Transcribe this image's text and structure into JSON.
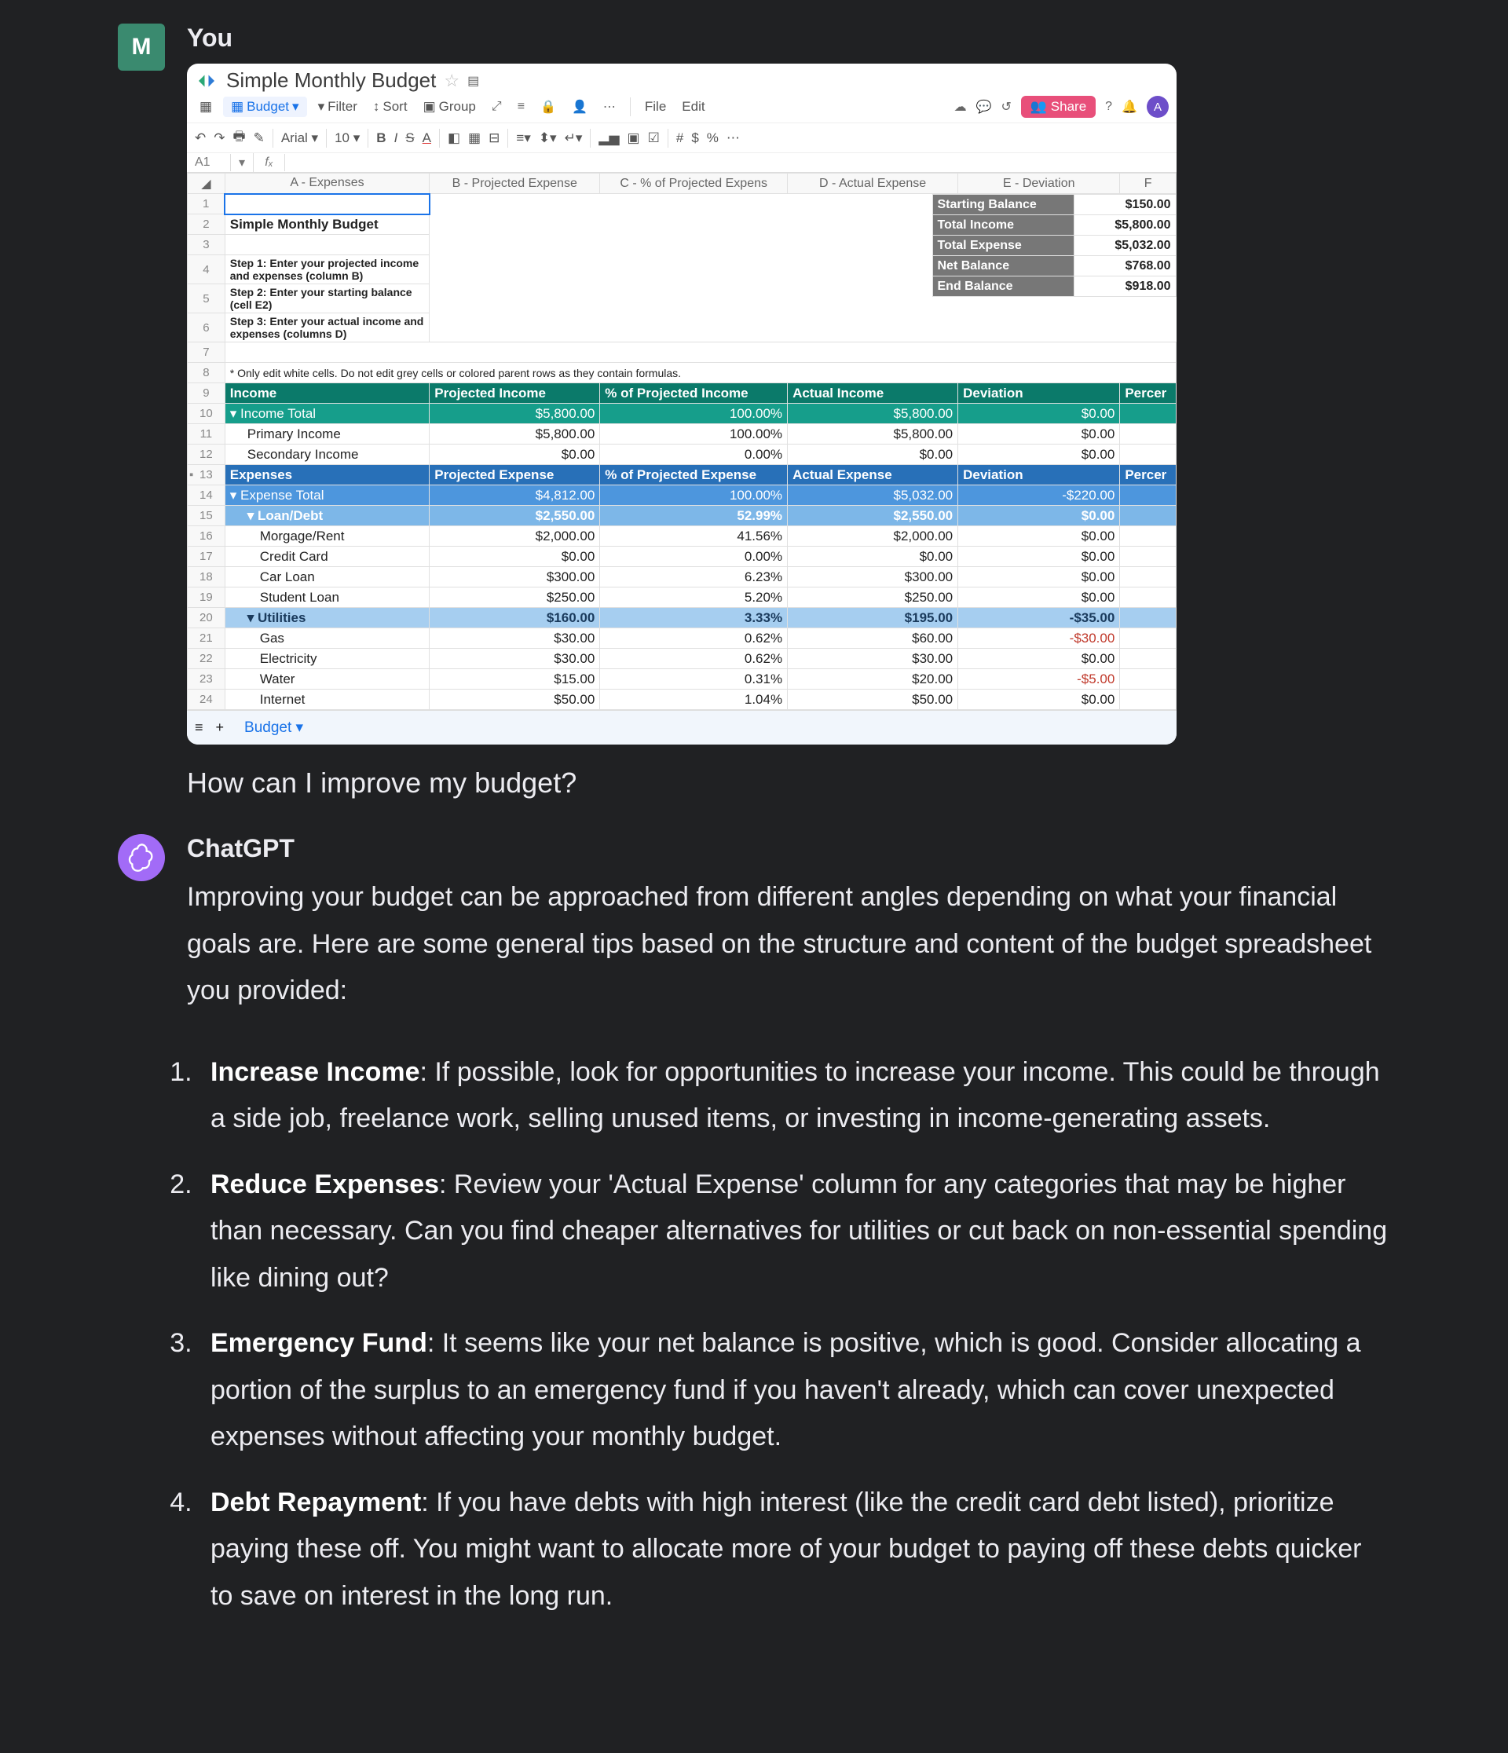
{
  "user": {
    "name": "You",
    "initial": "M",
    "question": "How can I improve my budget?"
  },
  "bot": {
    "name": "ChatGPT",
    "intro": "Improving your budget can be approached from different angles depending on what your financial goals are. Here are some general tips based on the structure and content of the budget spreadsheet you provided:",
    "tips": [
      {
        "title": "Increase Income",
        "body": ": If possible, look for opportunities to increase your income. This could be through a side job, freelance work, selling unused items, or investing in income-generating assets."
      },
      {
        "title": "Reduce Expenses",
        "body": ": Review your 'Actual Expense' column for any categories that may be higher than necessary. Can you find cheaper alternatives for utilities or cut back on non-essential spending like dining out?"
      },
      {
        "title": "Emergency Fund",
        "body": ": It seems like your net balance is positive, which is good. Consider allocating a portion of the surplus to an emergency fund if you haven't already, which can cover unexpected expenses without affecting your monthly budget."
      },
      {
        "title": "Debt Repayment",
        "body": ": If you have debts with high interest (like the credit card debt listed), prioritize paying these off. You might want to allocate more of your budget to paying off these debts quicker to save on interest in the long run."
      }
    ]
  },
  "sheet": {
    "doc_title": "Simple Monthly Budget",
    "tab_name": "Budget",
    "share_label": "Share",
    "avatar_letter": "A",
    "menu": {
      "file": "File",
      "edit": "Edit",
      "filter": "Filter",
      "sort": "Sort",
      "group": "Group"
    },
    "format": {
      "font": "Arial",
      "size": "10"
    },
    "cellref": "A1",
    "fx": "fₓ",
    "columns": {
      "a": "A - Expenses",
      "b": "B - Projected Expense",
      "c": "C - % of Projected Expens",
      "d": "D - Actual Expense",
      "e": "E - Deviation",
      "f": "F"
    },
    "title_cell": "Simple Monthly Budget",
    "steps": [
      "Step 1: Enter your projected income and expenses (column B)",
      "Step 2: Enter your starting balance (cell E2)",
      "Step 3: Enter your actual income and expenses (columns D)"
    ],
    "note": "* Only edit white cells. Do not edit grey cells or colored parent rows as they contain formulas.",
    "summary": [
      {
        "label": "Starting Balance",
        "value": "$150.00"
      },
      {
        "label": "Total Income",
        "value": "$5,800.00"
      },
      {
        "label": "Total Expense",
        "value": "$5,032.00"
      },
      {
        "label": "Net Balance",
        "value": "$768.00"
      },
      {
        "label": "End Balance",
        "value": "$918.00"
      }
    ],
    "income_header": {
      "a": "Income",
      "b": "Projected Income",
      "c": "% of Projected Income",
      "d": "Actual Income",
      "e": "Deviation",
      "f": "Percer"
    },
    "income_total": {
      "a": "Income Total",
      "b": "$5,800.00",
      "c": "100.00%",
      "d": "$5,800.00",
      "e": "$0.00"
    },
    "income_rows": [
      {
        "a": "Primary Income",
        "b": "$5,800.00",
        "c": "100.00%",
        "d": "$5,800.00",
        "e": "$0.00"
      },
      {
        "a": "Secondary Income",
        "b": "$0.00",
        "c": "0.00%",
        "d": "$0.00",
        "e": "$0.00"
      }
    ],
    "expense_header": {
      "a": "Expenses",
      "b": "Projected Expense",
      "c": "% of Projected Expense",
      "d": "Actual Expense",
      "e": "Deviation",
      "f": "Percer"
    },
    "expense_total": {
      "a": "Expense Total",
      "b": "$4,812.00",
      "c": "100.00%",
      "d": "$5,032.00",
      "e": "-$220.00",
      "neg": true
    },
    "loan_row": {
      "a": "Loan/Debt",
      "b": "$2,550.00",
      "c": "52.99%",
      "d": "$2,550.00",
      "e": "$0.00"
    },
    "loan_children": [
      {
        "a": "Morgage/Rent",
        "b": "$2,000.00",
        "c": "41.56%",
        "d": "$2,000.00",
        "e": "$0.00"
      },
      {
        "a": "Credit Card",
        "b": "$0.00",
        "c": "0.00%",
        "d": "$0.00",
        "e": "$0.00"
      },
      {
        "a": "Car Loan",
        "b": "$300.00",
        "c": "6.23%",
        "d": "$300.00",
        "e": "$0.00"
      },
      {
        "a": "Student Loan",
        "b": "$250.00",
        "c": "5.20%",
        "d": "$250.00",
        "e": "$0.00"
      }
    ],
    "util_row": {
      "a": "Utilities",
      "b": "$160.00",
      "c": "3.33%",
      "d": "$195.00",
      "e": "-$35.00",
      "neg": true
    },
    "util_children": [
      {
        "a": "Gas",
        "b": "$30.00",
        "c": "0.62%",
        "d": "$60.00",
        "e": "-$30.00",
        "neg": true
      },
      {
        "a": "Electricity",
        "b": "$30.00",
        "c": "0.62%",
        "d": "$30.00",
        "e": "$0.00"
      },
      {
        "a": "Water",
        "b": "$15.00",
        "c": "0.31%",
        "d": "$20.00",
        "e": "-$5.00",
        "neg": true
      },
      {
        "a": "Internet",
        "b": "$50.00",
        "c": "1.04%",
        "d": "$50.00",
        "e": "$0.00"
      }
    ],
    "footer_tab": "Budget"
  }
}
